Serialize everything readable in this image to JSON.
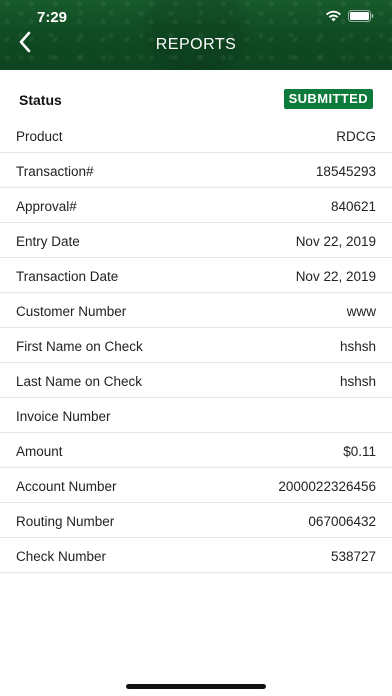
{
  "status_bar": {
    "time": "7:29",
    "wifi_icon": "wifi-icon",
    "battery_icon": "battery-icon"
  },
  "nav": {
    "title": "REPORTS",
    "back_icon": "chevron-left-icon"
  },
  "status": {
    "label": "Status",
    "badge": "SUBMITTED",
    "badge_color": "#0b7a3a"
  },
  "details": [
    {
      "label": "Product",
      "value": "RDCG"
    },
    {
      "label": "Transaction#",
      "value": "18545293"
    },
    {
      "label": "Approval#",
      "value": "840621"
    },
    {
      "label": "Entry Date",
      "value": "Nov 22, 2019"
    },
    {
      "label": "Transaction Date",
      "value": "Nov 22, 2019"
    },
    {
      "label": "Customer Number",
      "value": "www"
    },
    {
      "label": "First Name on Check",
      "value": "hshsh"
    },
    {
      "label": "Last Name on Check",
      "value": "hshsh"
    },
    {
      "label": "Invoice Number",
      "value": ""
    },
    {
      "label": "Amount",
      "value": "$0.11"
    },
    {
      "label": "Account Number",
      "value": "2000022326456"
    },
    {
      "label": "Routing Number",
      "value": "067006432"
    },
    {
      "label": "Check Number",
      "value": "538727"
    }
  ],
  "colors": {
    "header": "#135226",
    "badge": "#0b7a3a"
  }
}
